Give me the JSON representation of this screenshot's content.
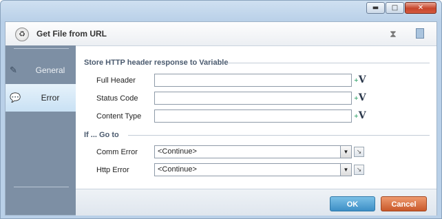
{
  "window": {
    "minimize_glyph": "▬",
    "maximize_glyph": "□",
    "close_glyph": "✕"
  },
  "header": {
    "title": "Get File from URL",
    "logo_icon": "recycle-icon",
    "hourglass_icon": "hourglass-icon",
    "clipboard_icon": "clipboard-icon"
  },
  "sidebar": {
    "items": [
      {
        "label": "General",
        "icon": "pencil-icon",
        "active": false
      },
      {
        "label": "Error",
        "icon": "speech-bubble-icon",
        "active": true
      }
    ]
  },
  "store_section": {
    "title": "Store HTTP header response to Variable",
    "fields": [
      {
        "label": "Full Header",
        "value": ""
      },
      {
        "label": "Status Code",
        "value": ""
      },
      {
        "label": "Content Type",
        "value": ""
      }
    ],
    "var_glyph": "V",
    "var_arrow": "+"
  },
  "goto_section": {
    "title": "If ... Go to",
    "rows": [
      {
        "label": "Comm Error",
        "value": "<Continue>"
      },
      {
        "label": "Http Error",
        "value": "<Continue>"
      }
    ]
  },
  "buttons": {
    "ok": "OK",
    "cancel": "Cancel"
  },
  "colors": {
    "ok": "#4f9fd3",
    "cancel": "#d46a3a",
    "sidebar": "#7d8fa4",
    "active_tab": "#d8eaf7"
  }
}
